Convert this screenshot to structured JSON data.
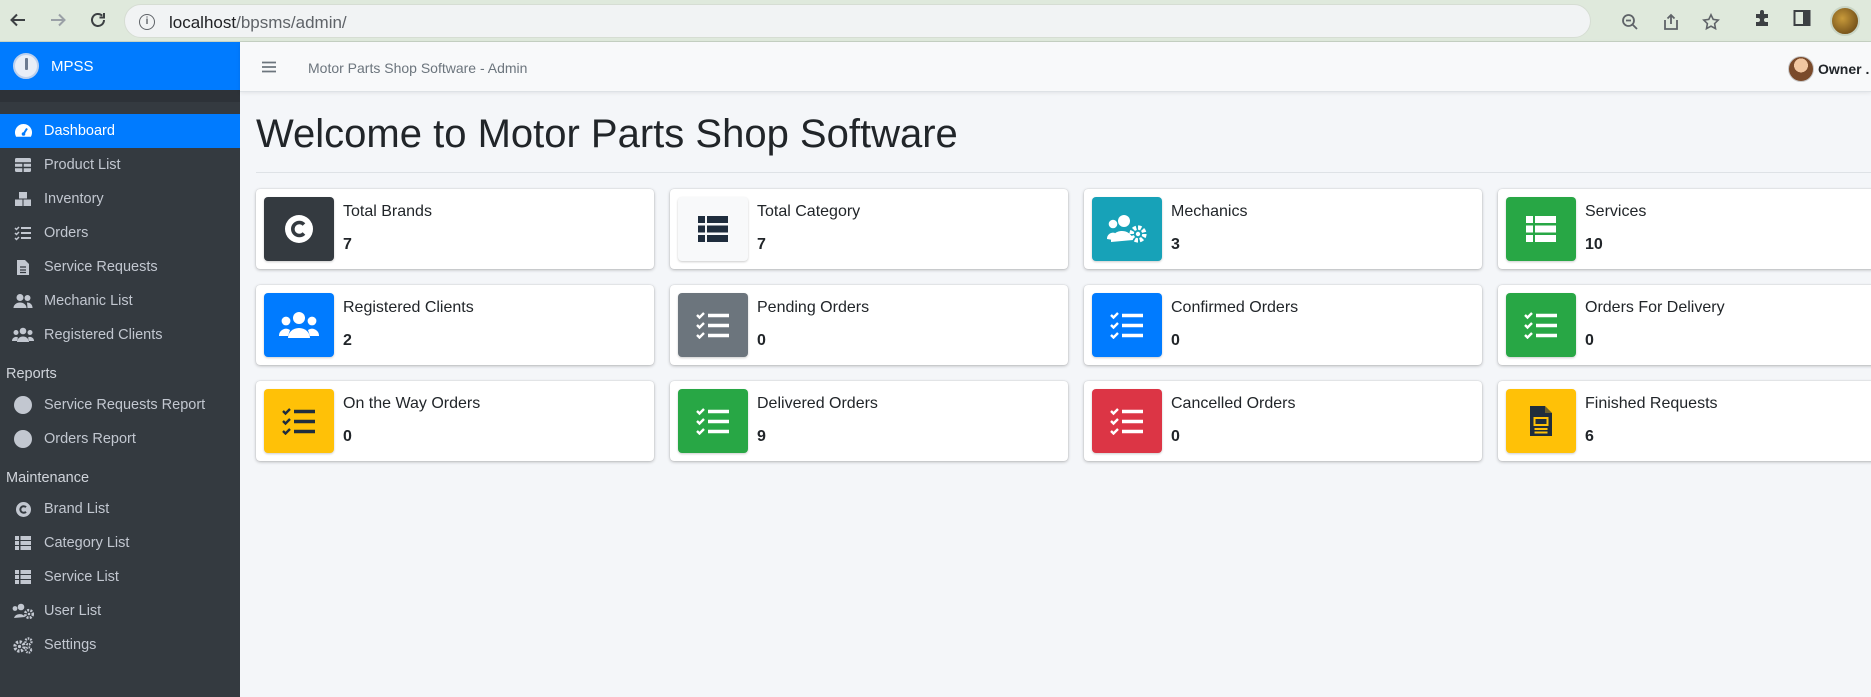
{
  "browser": {
    "url_host": "localhost",
    "url_path": "/bpsms/admin/"
  },
  "sidebar": {
    "brand": "MPSS",
    "items": [
      {
        "label": "Dashboard",
        "icon": "tachometer-icon",
        "active": true
      },
      {
        "label": "Product List",
        "icon": "table-icon"
      },
      {
        "label": "Inventory",
        "icon": "boxes-icon"
      },
      {
        "label": "Orders",
        "icon": "tasks-icon"
      },
      {
        "label": "Service Requests",
        "icon": "file-icon"
      },
      {
        "label": "Mechanic List",
        "icon": "user-friends-icon"
      },
      {
        "label": "Registered Clients",
        "icon": "users-icon"
      }
    ],
    "reports_header": "Reports",
    "reports": [
      {
        "label": "Service Requests Report",
        "icon": "circle-icon"
      },
      {
        "label": "Orders Report",
        "icon": "circle-icon"
      }
    ],
    "maintenance_header": "Maintenance",
    "maintenance": [
      {
        "label": "Brand List",
        "icon": "copyright-icon"
      },
      {
        "label": "Category List",
        "icon": "th-list-icon"
      },
      {
        "label": "Service List",
        "icon": "th-list-icon"
      },
      {
        "label": "User List",
        "icon": "users-cog-icon"
      },
      {
        "label": "Settings",
        "icon": "cogs-icon"
      }
    ]
  },
  "topnav": {
    "title": "Motor Parts Shop Software - Admin",
    "user": "Owner ."
  },
  "page_title": "Welcome to Motor Parts Shop Software",
  "cards": [
    {
      "label": "Total Brands",
      "value": "7",
      "icon": "copyright-icon",
      "color": "#343a40"
    },
    {
      "label": "Total Category",
      "value": "7",
      "icon": "th-list-icon",
      "color": "#f8f9fa"
    },
    {
      "label": "Mechanics",
      "value": "3",
      "icon": "users-cog-icon",
      "color": "#17a2b8"
    },
    {
      "label": "Services",
      "value": "10",
      "icon": "th-list-icon",
      "color": "#28a745"
    },
    {
      "label": "Registered Clients",
      "value": "2",
      "icon": "users-icon",
      "color": "#007bff"
    },
    {
      "label": "Pending Orders",
      "value": "0",
      "icon": "tasks-icon",
      "color": "#6c757d"
    },
    {
      "label": "Confirmed Orders",
      "value": "0",
      "icon": "tasks-icon",
      "color": "#007bff"
    },
    {
      "label": "Orders For Delivery",
      "value": "0",
      "icon": "tasks-icon",
      "color": "#28a745"
    },
    {
      "label": "On the Way Orders",
      "value": "0",
      "icon": "tasks-icon",
      "color": "#ffc107"
    },
    {
      "label": "Delivered Orders",
      "value": "9",
      "icon": "tasks-icon",
      "color": "#28a745"
    },
    {
      "label": "Cancelled Orders",
      "value": "0",
      "icon": "tasks-icon",
      "color": "#dc3545"
    },
    {
      "label": "Finished Requests",
      "value": "6",
      "icon": "file-icon",
      "color": "#ffc107"
    }
  ]
}
